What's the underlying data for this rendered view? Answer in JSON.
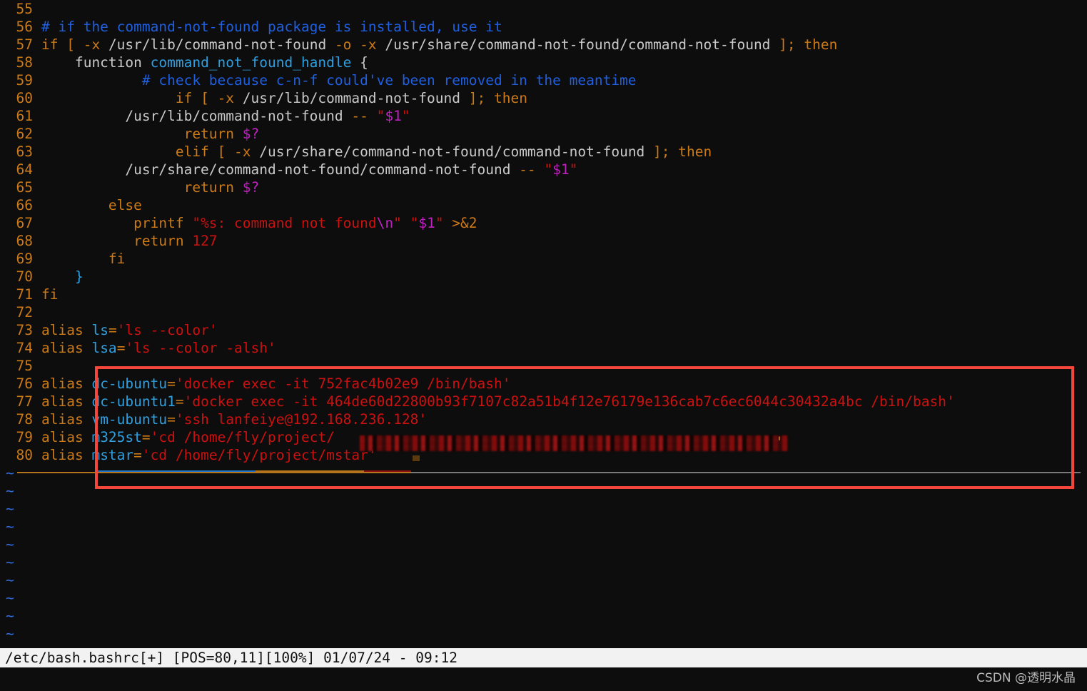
{
  "app": {
    "kind": "vim-editor",
    "background": "#0d0d0d"
  },
  "editor": {
    "first_line_number": 55,
    "lines": [
      {
        "num": "55",
        "tokens": []
      },
      {
        "num": "56",
        "tokens": [
          {
            "t": "# if the command-not-found package is installed, use it",
            "c": "c-comment"
          }
        ]
      },
      {
        "num": "57",
        "tokens": [
          {
            "t": "if ",
            "c": "c-keyword"
          },
          {
            "t": "[ ",
            "c": "c-op"
          },
          {
            "t": "-x",
            "c": "c-op"
          },
          {
            "t": " /usr/lib/command-not-found ",
            "c": "c-plain"
          },
          {
            "t": "-o -x",
            "c": "c-op"
          },
          {
            "t": " /usr/share/command-not-found/command-not-found ",
            "c": "c-plain"
          },
          {
            "t": "]; ",
            "c": "c-op"
          },
          {
            "t": "then",
            "c": "c-keyword"
          }
        ]
      },
      {
        "num": "58",
        "tokens": [
          {
            "t": "    function ",
            "c": "c-plain"
          },
          {
            "t": "command_not_found_handle",
            "c": "c-func"
          },
          {
            "t": " {",
            "c": "c-plain"
          }
        ]
      },
      {
        "num": "59",
        "tokens": [
          {
            "t": "            # check because c-n-f could've been removed in the meantime",
            "c": "c-comment"
          }
        ]
      },
      {
        "num": "60",
        "tokens": [
          {
            "t": "                if ",
            "c": "c-keyword"
          },
          {
            "t": "[ ",
            "c": "c-op"
          },
          {
            "t": "-x",
            "c": "c-op"
          },
          {
            "t": " /usr/lib/command-not-found ",
            "c": "c-plain"
          },
          {
            "t": "]; ",
            "c": "c-op"
          },
          {
            "t": "then",
            "c": "c-keyword"
          }
        ]
      },
      {
        "num": "61",
        "tokens": [
          {
            "t": "          /usr/lib/command-not-found ",
            "c": "c-plain"
          },
          {
            "t": "--",
            "c": "c-op"
          },
          {
            "t": " \"",
            "c": "c-string"
          },
          {
            "t": "$1",
            "c": "c-special"
          },
          {
            "t": "\"",
            "c": "c-string"
          }
        ]
      },
      {
        "num": "62",
        "tokens": [
          {
            "t": "                 return ",
            "c": "c-keyword"
          },
          {
            "t": "$?",
            "c": "c-special"
          }
        ]
      },
      {
        "num": "63",
        "tokens": [
          {
            "t": "                elif ",
            "c": "c-keyword"
          },
          {
            "t": "[ ",
            "c": "c-op"
          },
          {
            "t": "-x",
            "c": "c-op"
          },
          {
            "t": " /usr/share/command-not-found/command-not-found ",
            "c": "c-plain"
          },
          {
            "t": "]; ",
            "c": "c-op"
          },
          {
            "t": "then",
            "c": "c-keyword"
          }
        ]
      },
      {
        "num": "64",
        "tokens": [
          {
            "t": "          /usr/share/command-not-found/command-not-found ",
            "c": "c-plain"
          },
          {
            "t": "--",
            "c": "c-op"
          },
          {
            "t": " \"",
            "c": "c-string"
          },
          {
            "t": "$1",
            "c": "c-special"
          },
          {
            "t": "\"",
            "c": "c-string"
          }
        ]
      },
      {
        "num": "65",
        "tokens": [
          {
            "t": "                 return ",
            "c": "c-keyword"
          },
          {
            "t": "$?",
            "c": "c-special"
          }
        ]
      },
      {
        "num": "66",
        "tokens": [
          {
            "t": "        else",
            "c": "c-keyword"
          }
        ]
      },
      {
        "num": "67",
        "tokens": [
          {
            "t": "           printf ",
            "c": "c-keyword"
          },
          {
            "t": "\"%s: command not found",
            "c": "c-string"
          },
          {
            "t": "\\n",
            "c": "c-special"
          },
          {
            "t": "\" ",
            "c": "c-string"
          },
          {
            "t": "\"",
            "c": "c-string"
          },
          {
            "t": "$1",
            "c": "c-special"
          },
          {
            "t": "\" ",
            "c": "c-string"
          },
          {
            "t": ">&2",
            "c": "c-op"
          }
        ]
      },
      {
        "num": "68",
        "tokens": [
          {
            "t": "           return ",
            "c": "c-keyword"
          },
          {
            "t": "127",
            "c": "c-number"
          }
        ]
      },
      {
        "num": "69",
        "tokens": [
          {
            "t": "        fi",
            "c": "c-keyword"
          }
        ]
      },
      {
        "num": "70",
        "tokens": [
          {
            "t": "    }",
            "c": "c-func"
          }
        ]
      },
      {
        "num": "71",
        "tokens": [
          {
            "t": "fi",
            "c": "c-keyword"
          }
        ]
      },
      {
        "num": "72",
        "tokens": []
      },
      {
        "num": "73",
        "tokens": [
          {
            "t": "alias ",
            "c": "c-keyword"
          },
          {
            "t": "ls",
            "c": "c-ident"
          },
          {
            "t": "=",
            "c": "c-op"
          },
          {
            "t": "'ls --color'",
            "c": "c-string"
          }
        ]
      },
      {
        "num": "74",
        "tokens": [
          {
            "t": "alias ",
            "c": "c-keyword"
          },
          {
            "t": "lsa",
            "c": "c-ident"
          },
          {
            "t": "=",
            "c": "c-op"
          },
          {
            "t": "'ls --color -alsh'",
            "c": "c-string"
          }
        ]
      },
      {
        "num": "75",
        "tokens": []
      },
      {
        "num": "76",
        "tokens": [
          {
            "t": "alias ",
            "c": "c-keyword"
          },
          {
            "t": "dc-ubuntu",
            "c": "c-ident"
          },
          {
            "t": "=",
            "c": "c-op"
          },
          {
            "t": "'docker exec -it 752fac4b02e9 /bin/bash'",
            "c": "c-string"
          }
        ]
      },
      {
        "num": "77",
        "tokens": [
          {
            "t": "alias ",
            "c": "c-keyword"
          },
          {
            "t": "dc-ubuntu1",
            "c": "c-ident"
          },
          {
            "t": "=",
            "c": "c-op"
          },
          {
            "t": "'docker exec -it 464de60d22800b93f7107c82a51b4f12e76179e136cab7c6ec6044c30432a4bc /bin/bash'",
            "c": "c-string"
          }
        ]
      },
      {
        "num": "78",
        "tokens": [
          {
            "t": "alias ",
            "c": "c-keyword"
          },
          {
            "t": "vm-ubuntu",
            "c": "c-ident"
          },
          {
            "t": "=",
            "c": "c-op"
          },
          {
            "t": "'ssh lanfeiye@192.168.236.128'",
            "c": "c-string"
          }
        ]
      },
      {
        "num": "79",
        "tokens": [
          {
            "t": "alias ",
            "c": "c-keyword"
          },
          {
            "t": "m325st",
            "c": "c-ident"
          },
          {
            "t": "=",
            "c": "c-op"
          },
          {
            "t": "'cd /home/fly/project/",
            "c": "c-string"
          }
        ]
      },
      {
        "num": "80",
        "tokens": [
          {
            "t": "alias ",
            "c": "c-keyword"
          },
          {
            "t": "mstar",
            "c": "c-ident"
          },
          {
            "t": "=",
            "c": "c-op"
          },
          {
            "t": "'cd /home/fly/project/mstar'",
            "c": "c-string"
          }
        ]
      }
    ],
    "empty_buffer_marker": "~",
    "empty_buffer_rows": 10
  },
  "redaction": {
    "line_number": "79",
    "note_char": "'"
  },
  "annotation_box": {
    "color": "#f5463c"
  },
  "statusbar": {
    "text": "/etc/bash.bashrc[+] [POS=80,11][100%] 01/07/24 - 09:12",
    "file": "/etc/bash.bashrc",
    "modified_flag": "[+]",
    "position": "[POS=80,11]",
    "percent": "[100%]",
    "date": "01/07/24",
    "time": "09:12"
  },
  "watermark": {
    "text": "CSDN @透明水晶"
  }
}
